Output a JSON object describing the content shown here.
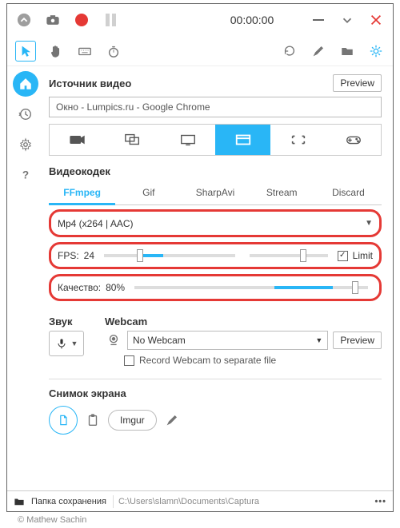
{
  "topbar": {
    "timer": "00:00:00"
  },
  "source": {
    "title": "Источник видео",
    "preview_btn": "Preview",
    "value": "Окно  -  Lumpics.ru - Google Chrome"
  },
  "codec": {
    "title": "Видеокодек",
    "tabs": {
      "ffmpeg": "FFmpeg",
      "gif": "Gif",
      "sharpavi": "SharpAvi",
      "stream": "Stream",
      "discard": "Discard"
    },
    "format": "Mp4 (x264 | AAC)",
    "fps_label": "FPS:",
    "fps_value": "24",
    "limit_label": "Limit",
    "quality_label": "Качество:",
    "quality_value": "80%"
  },
  "sound": {
    "title": "Звук",
    "webcam_title": "Webcam",
    "webcam_value": "No Webcam",
    "webcam_preview": "Preview",
    "webcam_separate": "Record Webcam to separate file"
  },
  "screenshot": {
    "title": "Снимок экрана",
    "imgur": "Imgur"
  },
  "statusbar": {
    "folder_label": "Папка сохранения",
    "path": "C:\\Users\\slamn\\Documents\\Captura",
    "more": "•••"
  },
  "copyright": "© Mathew Sachin"
}
